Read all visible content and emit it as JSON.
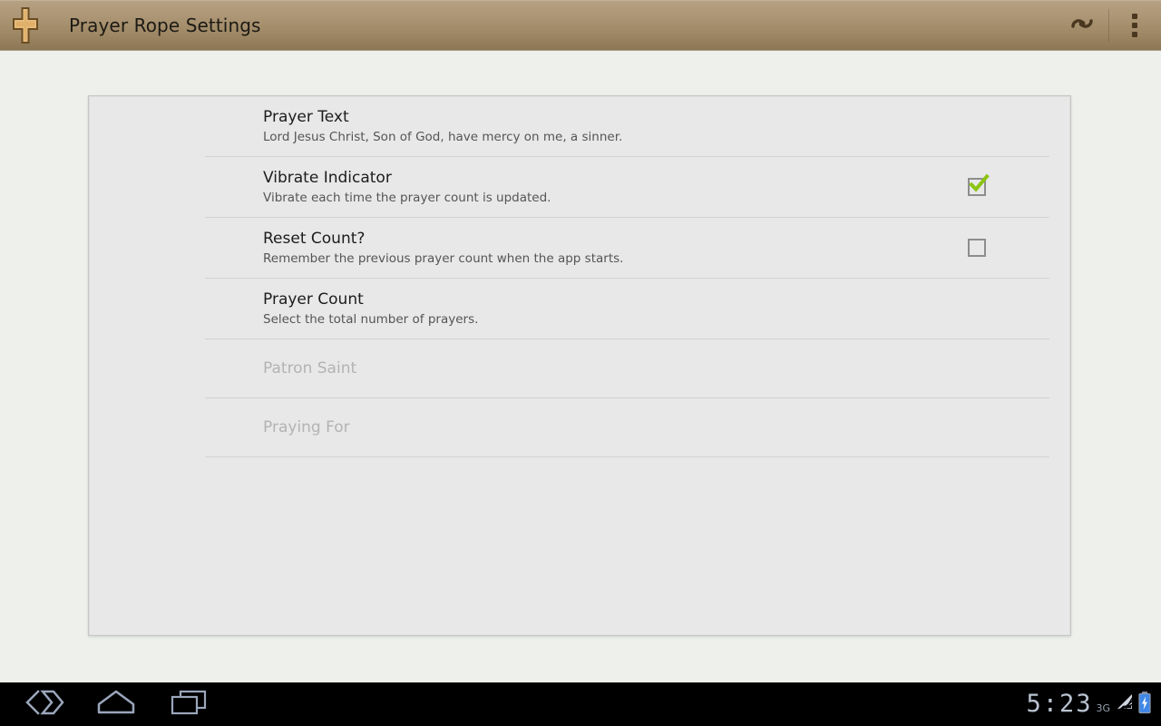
{
  "action_bar": {
    "logo_icon": "cross-icon",
    "title": "Prayer Rope Settings",
    "actions": [
      {
        "icon": "reset-counter-icon",
        "name": "reset-count-action"
      },
      {
        "icon": "overflow-menu-icon",
        "name": "overflow-menu-button"
      }
    ],
    "colors": {
      "gradient_top": "#b6a183",
      "gradient_bottom": "#8b7552",
      "title_text": "#1d1a14",
      "icon": "#4a3720",
      "logo_fill": "#e0b06a",
      "logo_stroke": "#6e4f24"
    }
  },
  "settings": {
    "card_background": "#e8e8e8",
    "items": [
      {
        "title": "Prayer Text",
        "summary": "Lord Jesus Christ, Son of God, have mercy on me, a sinner.",
        "widget": "none",
        "enabled": true,
        "name": "pref-prayer-text"
      },
      {
        "title": "Vibrate Indicator",
        "summary": "Vibrate each time the prayer count is updated.",
        "widget": "checkbox",
        "checked": true,
        "enabled": true,
        "name": "pref-vibrate-indicator"
      },
      {
        "title": "Reset Count?",
        "summary": "Remember the previous prayer count when the app starts.",
        "widget": "checkbox",
        "checked": false,
        "enabled": true,
        "name": "pref-reset-count"
      },
      {
        "title": "Prayer Count",
        "summary": "Select the total number of prayers.",
        "widget": "none",
        "enabled": true,
        "name": "pref-prayer-count"
      },
      {
        "title": "Patron Saint",
        "summary": "",
        "widget": "none",
        "enabled": false,
        "name": "pref-patron-saint"
      },
      {
        "title": "Praying For",
        "summary": "",
        "widget": "none",
        "enabled": false,
        "name": "pref-praying-for"
      }
    ],
    "checkbox_colors": {
      "border": "#8d8d8d",
      "check": "#8cc413"
    }
  },
  "system_bar": {
    "background": "#000000",
    "nav": [
      {
        "icon": "back-icon",
        "name": "nav-back-button"
      },
      {
        "icon": "home-icon",
        "name": "nav-home-button"
      },
      {
        "icon": "recents-icon",
        "name": "nav-recents-button"
      }
    ],
    "status": {
      "clock": "5:23",
      "network_type": "3G",
      "signal_icon": "signal-bars-icon",
      "battery_icon": "battery-charging-icon",
      "clock_color": "#b9c2d0"
    }
  }
}
